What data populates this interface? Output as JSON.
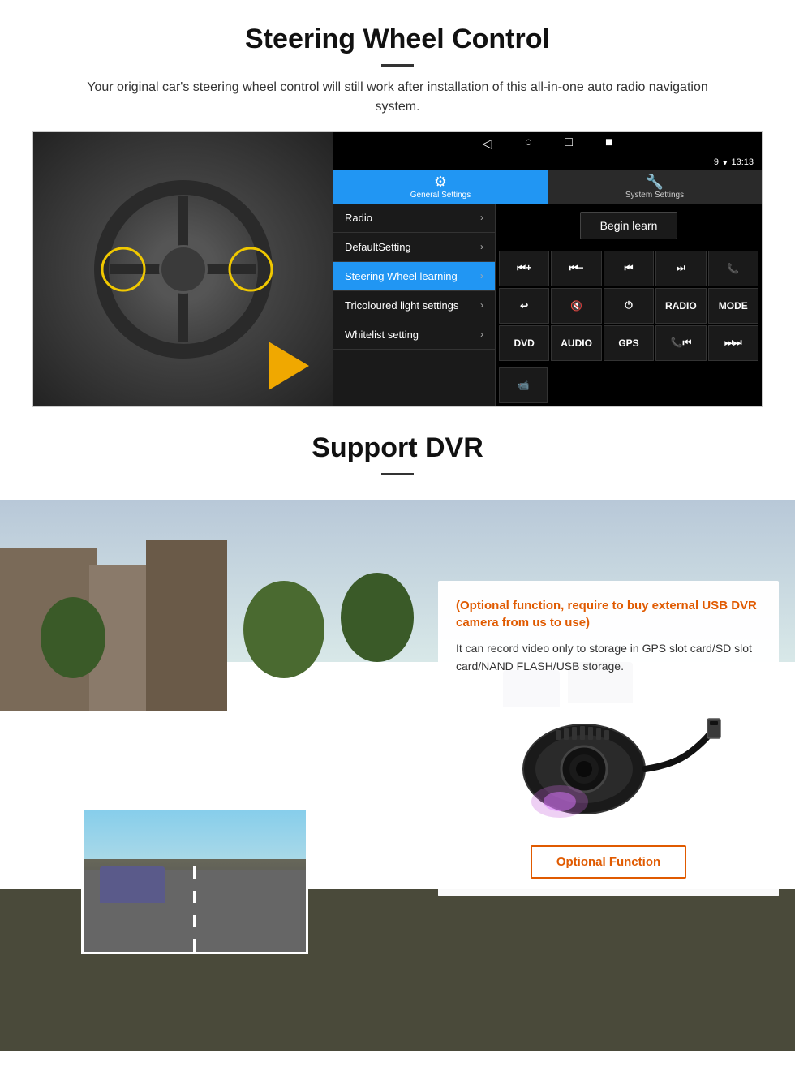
{
  "steering_section": {
    "title": "Steering Wheel Control",
    "description": "Your original car's steering wheel control will still work after installation of this all-in-one auto radio navigation system.",
    "statusbar": {
      "signal": "9",
      "wifi": "▾",
      "time": "13:13"
    },
    "tabs": [
      {
        "id": "general",
        "label": "General Settings",
        "active": true
      },
      {
        "id": "system",
        "label": "System Settings",
        "active": false
      }
    ],
    "menu_items": [
      {
        "label": "Radio",
        "active": false
      },
      {
        "label": "DefaultSetting",
        "active": false
      },
      {
        "label": "Steering Wheel learning",
        "active": true
      },
      {
        "label": "Tricoloured light settings",
        "active": false
      },
      {
        "label": "Whitelist setting",
        "active": false
      }
    ],
    "begin_learn_label": "Begin learn",
    "control_buttons": [
      [
        "⏮+",
        "⏮−",
        "⏮⏮",
        "⏭⏭",
        "📞"
      ],
      [
        "↩",
        "🔇×",
        "⏻",
        "RADIO",
        "MODE"
      ],
      [
        "DVD",
        "AUDIO",
        "GPS",
        "📞⏮",
        "⏭⏭"
      ]
    ],
    "dvd_row": [
      "DVD",
      "AUDIO",
      "GPS",
      "📞⏮",
      "⏭⏭"
    ],
    "extra_btn": "📹"
  },
  "dvr_section": {
    "title": "Support DVR",
    "optional_text": "(Optional function, require to buy external USB DVR camera from us to use)",
    "desc_text": "It can record video only to storage in GPS slot card/SD slot card/NAND FLASH/USB storage.",
    "optional_function_label": "Optional Function"
  }
}
